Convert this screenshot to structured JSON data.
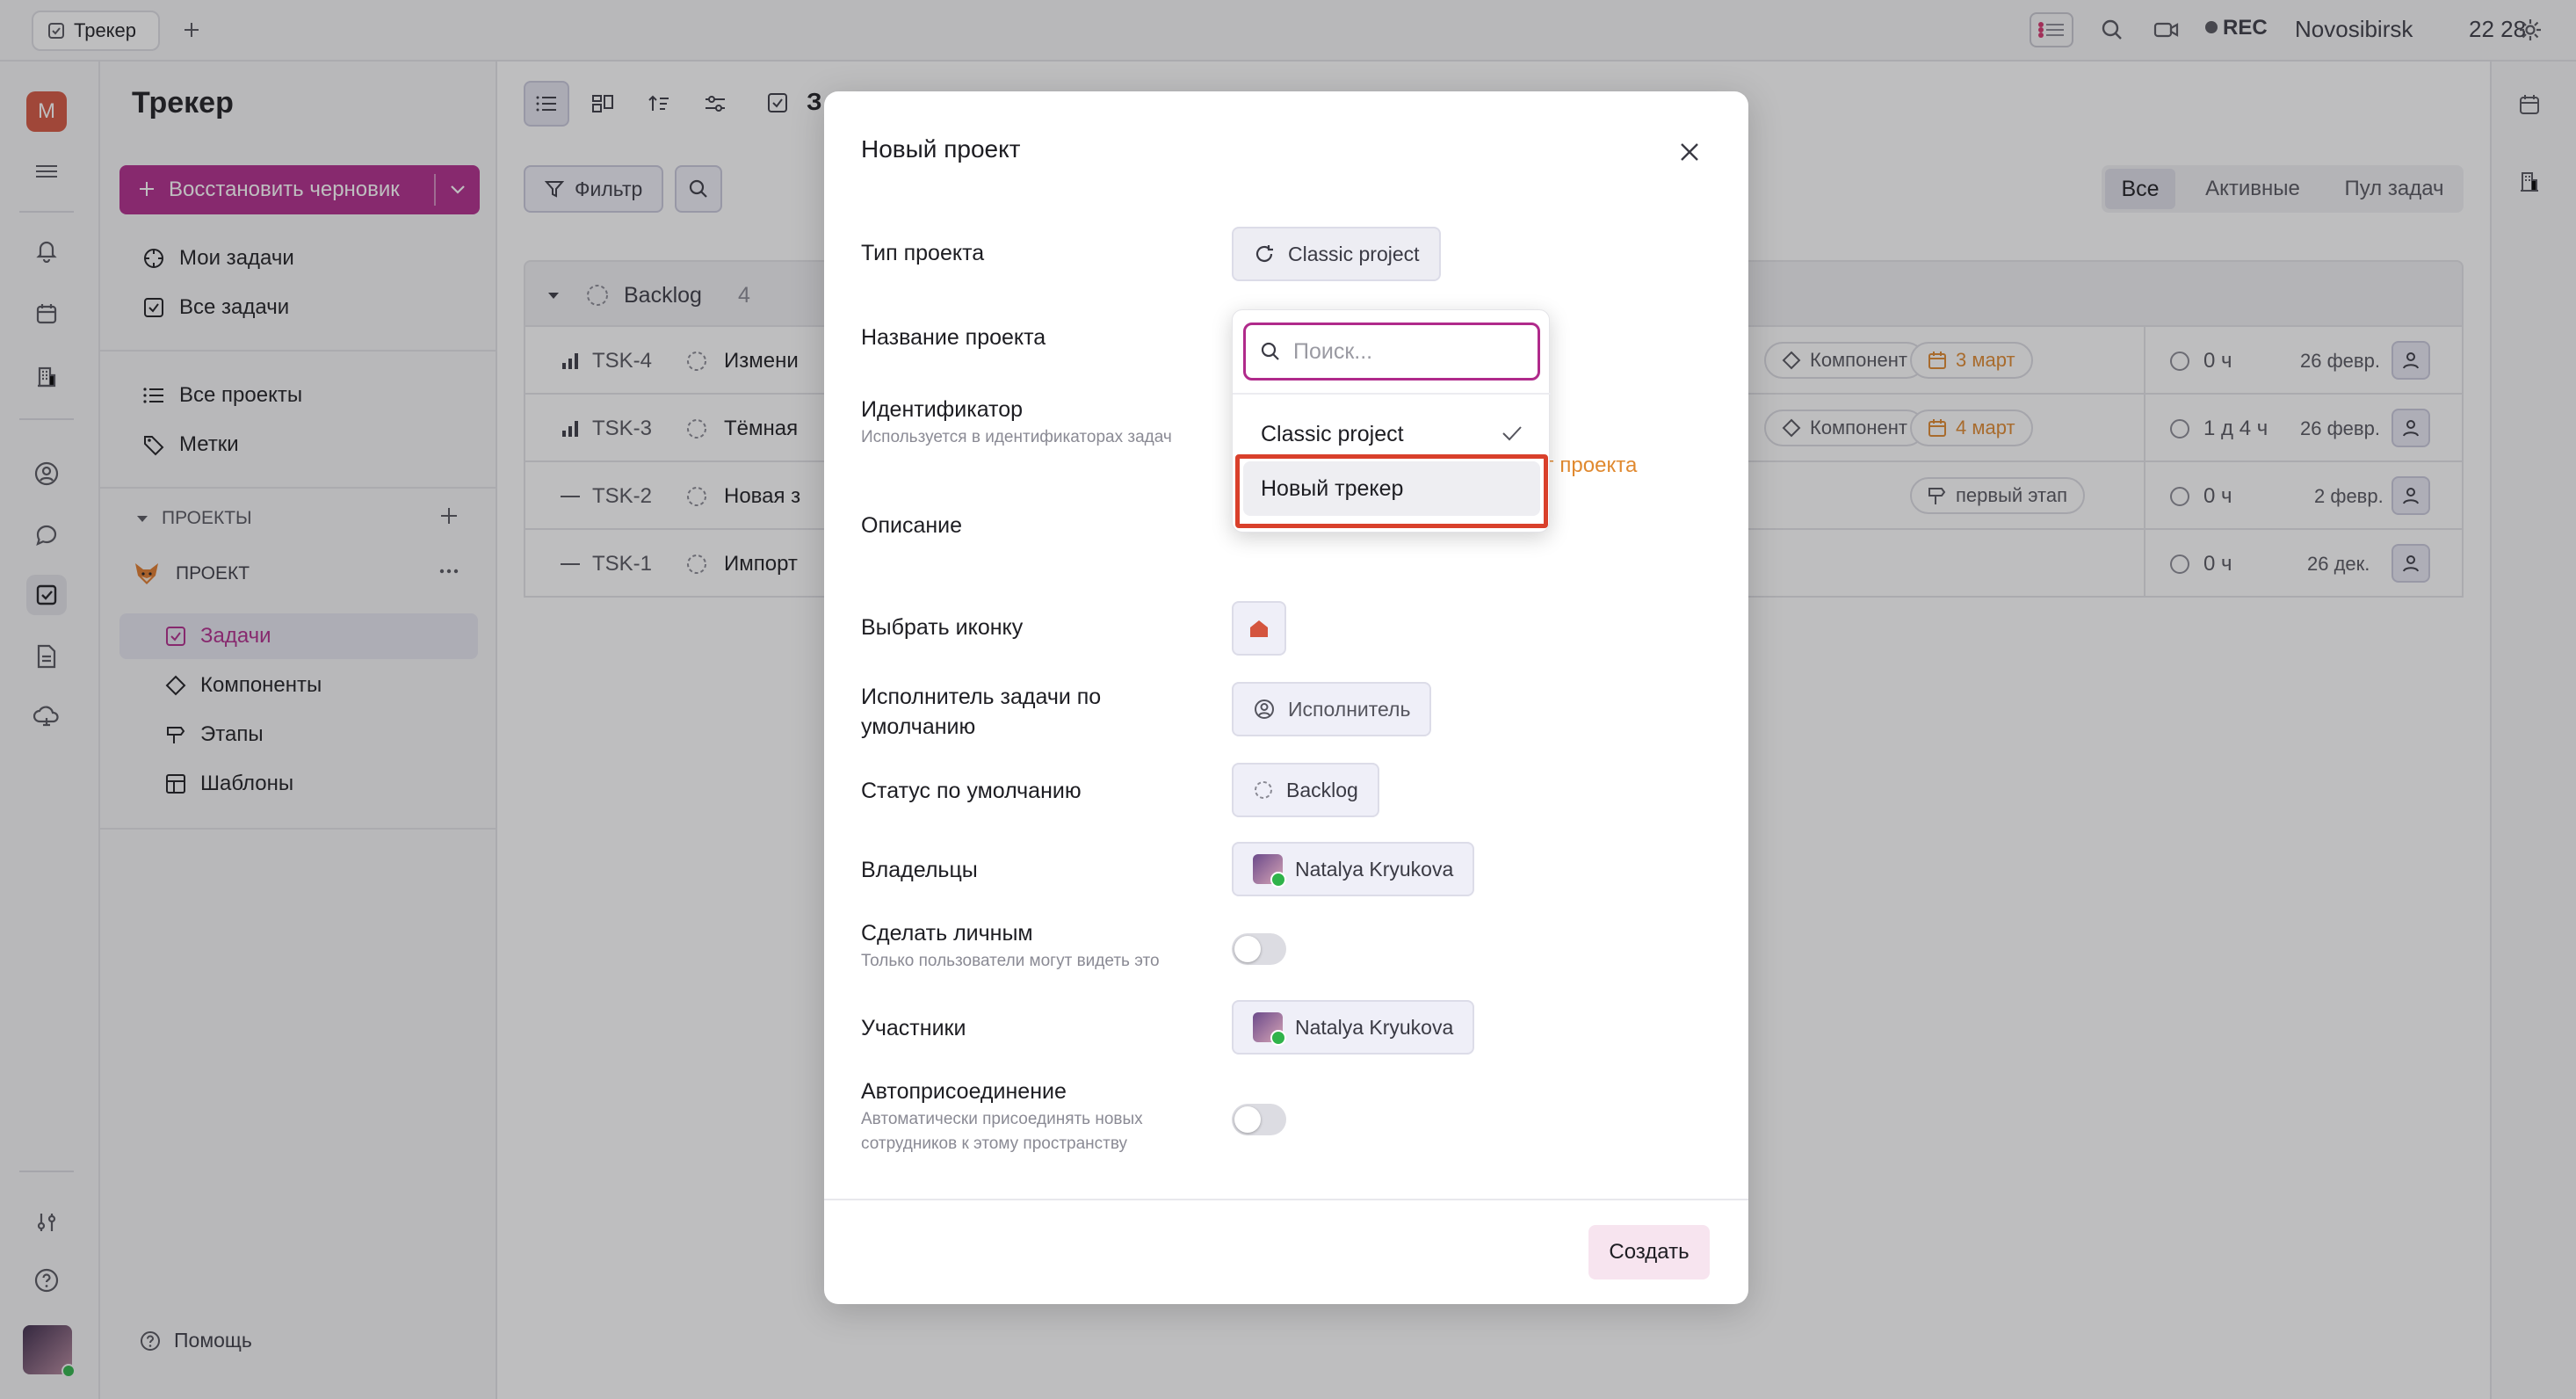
{
  "window": {
    "tab_title": "Трекер",
    "rec_label": "REC",
    "location": "Novosibirsk",
    "time": "22 28"
  },
  "rail": {
    "workspace_letter": "M"
  },
  "sidebar": {
    "title": "Трекер",
    "restore_draft_label": "Восстановить черновик",
    "nav": [
      {
        "label": "Мои задачи"
      },
      {
        "label": "Все задачи"
      },
      {
        "label": "Все проекты"
      },
      {
        "label": "Метки"
      }
    ],
    "projects_header": "ПРОЕКТЫ",
    "project_name": "ПРОЕКТ",
    "project_items": [
      {
        "label": "Задачи"
      },
      {
        "label": "Компоненты"
      },
      {
        "label": "Этапы"
      },
      {
        "label": "Шаблоны"
      }
    ],
    "help_label": "Помощь"
  },
  "main": {
    "filter_label": "Фильтр",
    "header_partial": "З",
    "view_tabs": [
      "Все",
      "Активные",
      "Пул задач"
    ],
    "group": {
      "name": "Backlog",
      "count": "4"
    },
    "rows": [
      {
        "id": "TSK-4",
        "title": "Измени",
        "component": "Компонент",
        "date": "3 март",
        "time": "0 ч",
        "created": "26 февр.",
        "priority": "high"
      },
      {
        "id": "TSK-3",
        "title": "Тёмная",
        "component": "Компонент",
        "date": "4 март",
        "time": "1 д 4 ч",
        "created": "26 февр.",
        "priority": "high"
      },
      {
        "id": "TSK-2",
        "title": "Новая з",
        "milestone": "первый этап",
        "time": "0 ч",
        "created": "2 февр.",
        "priority": "none"
      },
      {
        "id": "TSK-1",
        "title": "Импорт",
        "time": "0 ч",
        "created": "26 дек.",
        "priority": "none"
      }
    ]
  },
  "modal": {
    "title": "Новый проект",
    "type_label": "Тип проекта",
    "type_value": "Classic project",
    "name_label": "Название проекта",
    "identifier_label": "Идентификатор",
    "identifier_hint": "Используется в идентификаторах задач",
    "identifier_partial": "г проекта",
    "description_label": "Описание",
    "icon_label": "Выбрать иконку",
    "assignee_label": "Исполнитель задачи по умолчанию",
    "assignee_value": "Исполнитель",
    "status_label": "Статус по умолчанию",
    "status_value": "Backlog",
    "owners_label": "Владельцы",
    "owner_name": "Natalya Kryukova",
    "private_label": "Сделать личным",
    "private_hint": "Только пользователи могут видеть это",
    "members_label": "Участники",
    "member_name": "Natalya Kryukova",
    "autojoin_label": "Автоприсоединение",
    "autojoin_hint": "Автоматически присоединять новых сотрудников к этому пространству",
    "create_label": "Создать"
  },
  "dropdown": {
    "search_placeholder": "Поиск...",
    "options": [
      {
        "label": "Classic project",
        "selected": true
      },
      {
        "label": "Новый трекер",
        "selected": false
      }
    ]
  },
  "colors": {
    "accent": "#b02a8b",
    "highlight_border": "#d9402b",
    "warning": "#e0892f"
  }
}
